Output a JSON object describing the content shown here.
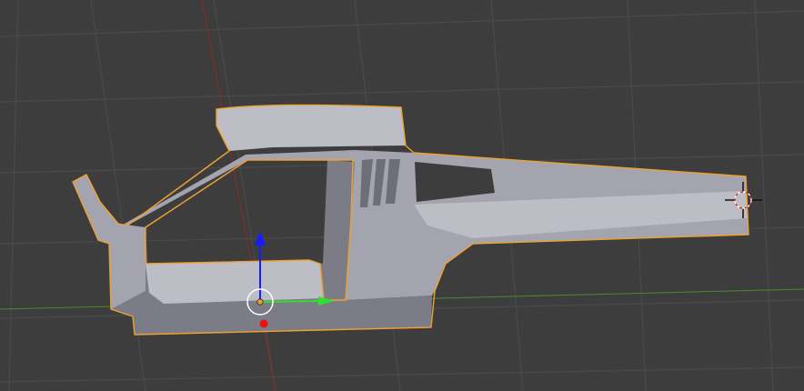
{
  "viewport": {
    "background": "#3d3d3d",
    "grid_color": "#4a4a4a",
    "x_axis_color": "#8c2b2b",
    "y_axis_color": "#4e8a2c"
  },
  "selected_object": {
    "body_color": "#a4a4ae",
    "body_light": "#bdbdc6",
    "body_dark": "#7c7c86",
    "outline_color": "#f0a030"
  },
  "gizmo": {
    "z_arrow_color": "#1a1aff",
    "y_arrow_color": "#33dd33",
    "x_handle_color": "#ee1111",
    "icon": "transform-gizmo-icon"
  },
  "cursor": {
    "icon": "3d-cursor-icon"
  }
}
